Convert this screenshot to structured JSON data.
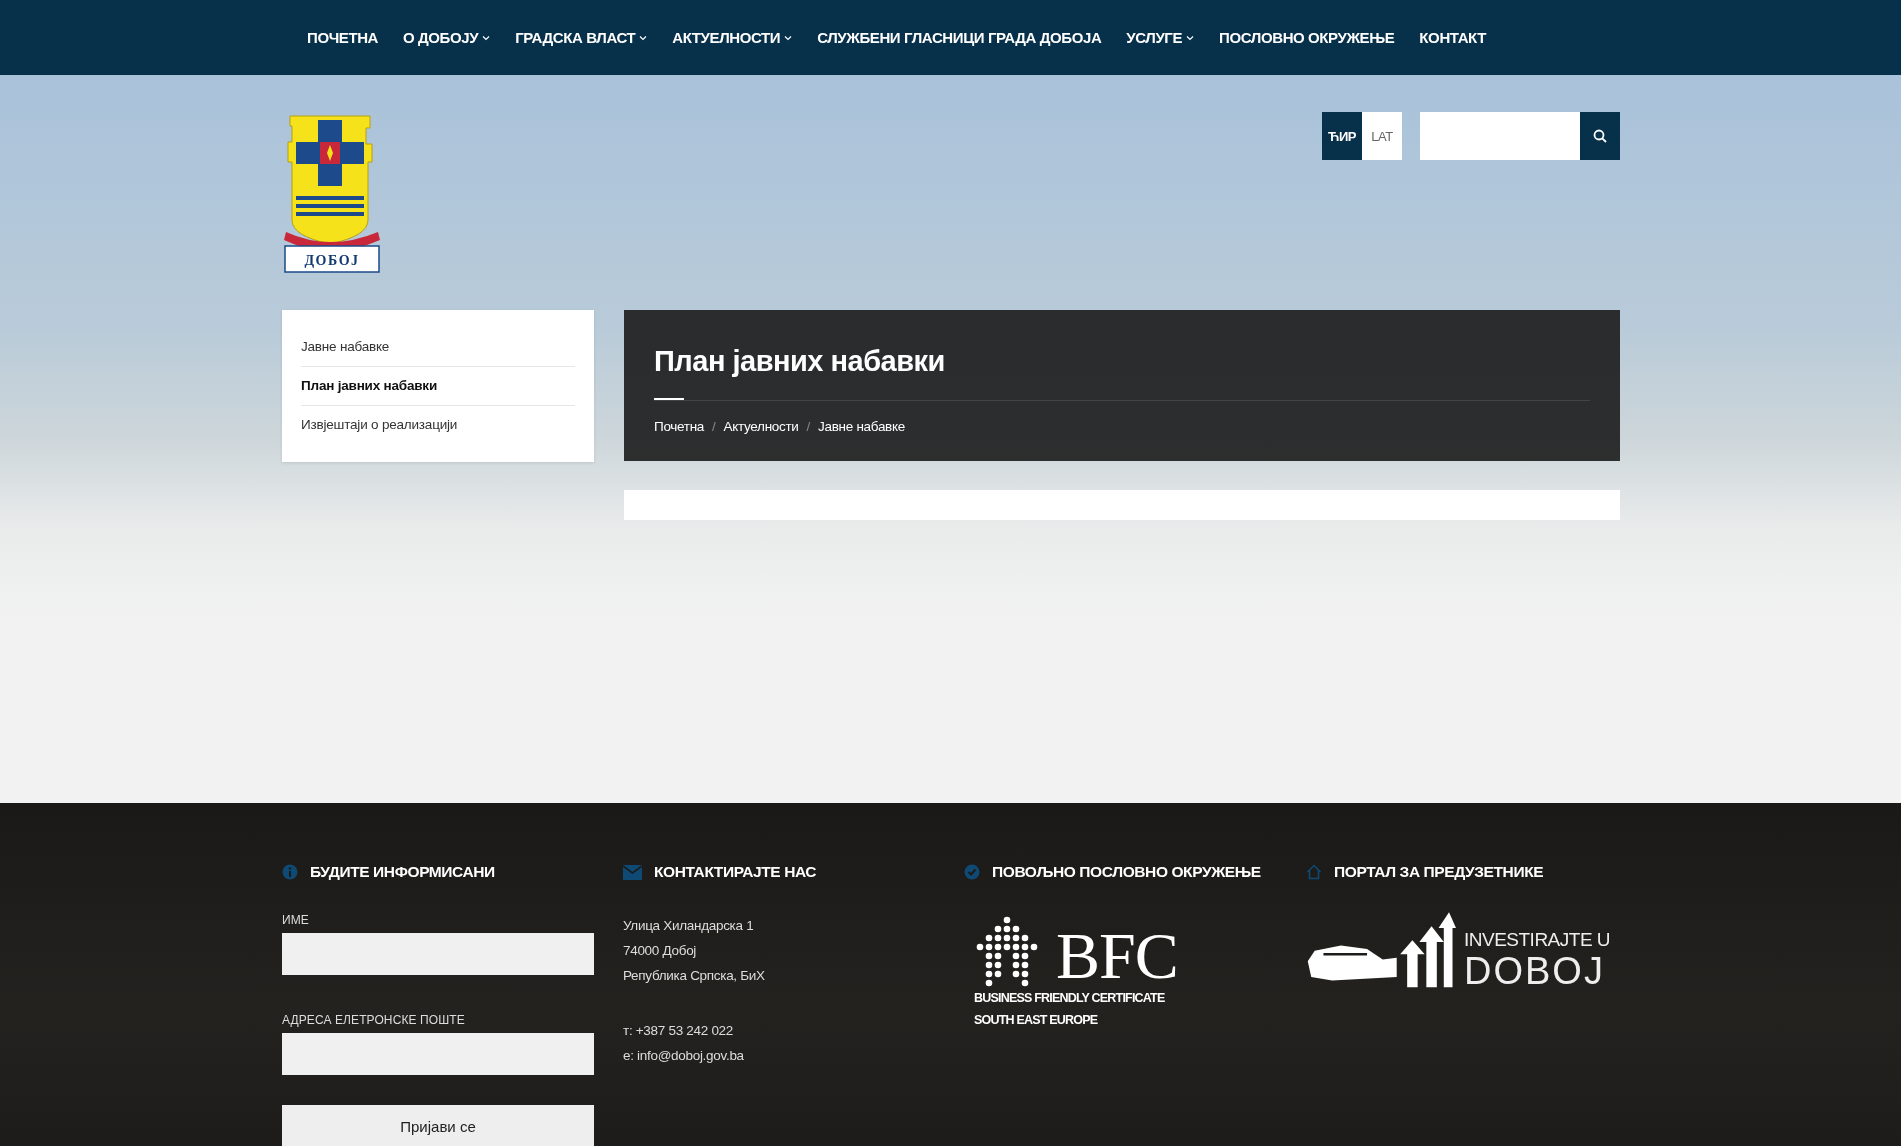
{
  "nav": [
    {
      "label": "ПОЧЕТНА",
      "dropdown": false
    },
    {
      "label": "О ДОБОЈУ",
      "dropdown": true
    },
    {
      "label": "ГРАДСКА ВЛАСТ",
      "dropdown": true
    },
    {
      "label": "АКТУЕЛНОСТИ",
      "dropdown": true
    },
    {
      "label": "СЛУЖБЕНИ ГЛАСНИЦИ ГРАДА ДОБОЈА",
      "dropdown": false
    },
    {
      "label": "УСЛУГЕ",
      "dropdown": true
    },
    {
      "label": "ПОСЛОВНО ОКРУЖЕЊЕ",
      "dropdown": false
    },
    {
      "label": "КОНТАКТ",
      "dropdown": false
    }
  ],
  "logo": {
    "ribbon_text": "ДОБОЈ"
  },
  "language": [
    {
      "label": "ЋИР",
      "selected": true
    },
    {
      "label": "LAT",
      "selected": false
    }
  ],
  "sidebar": {
    "items": [
      {
        "label": "Јавне набавке",
        "selected": false
      },
      {
        "label": "План јавних набавки",
        "selected": true
      },
      {
        "label": "Извјештаји о реализацији",
        "selected": false
      }
    ]
  },
  "page": {
    "title": "План јавних набавки",
    "breadcrumb_separator": "/",
    "breadcrumb": [
      "Почетна",
      "Актуелности",
      "Јавне набавке"
    ]
  },
  "footer": {
    "columns": [
      {
        "kind": "newsletter",
        "heading": "БУДИТЕ ИНФОРМИСАНИ",
        "fields": [
          {
            "label": "ИМЕ"
          },
          {
            "label": "АДРЕСА ЕЛЕТРОНСКЕ ПОШТЕ"
          }
        ],
        "button": "Пријави се"
      },
      {
        "kind": "contact",
        "heading": "КОНТАКТИРАЈТЕ НАС",
        "address": [
          "Улица Хиландарска 1",
          "74000 Добој",
          "Република Српска, БиХ"
        ],
        "phone": "т: +387 53 242 022",
        "email": "e: info@doboj.gov.ba"
      },
      {
        "kind": "bfc",
        "heading": "ПОВОЉНО ПОСЛОВНО ОКРУЖЕЊЕ",
        "logo_title": "BFC",
        "logo_lines": [
          "BUSINESS FRIENDLY CERTIFICATE",
          "SOUTH EAST EUROPE"
        ]
      },
      {
        "kind": "invest",
        "heading": "ПОРТАЛ ЗА ПРЕДУЗЕТНИКЕ",
        "logo_lines": [
          "INVESTIRAJTE U",
          "DOBOJ"
        ]
      }
    ]
  }
}
